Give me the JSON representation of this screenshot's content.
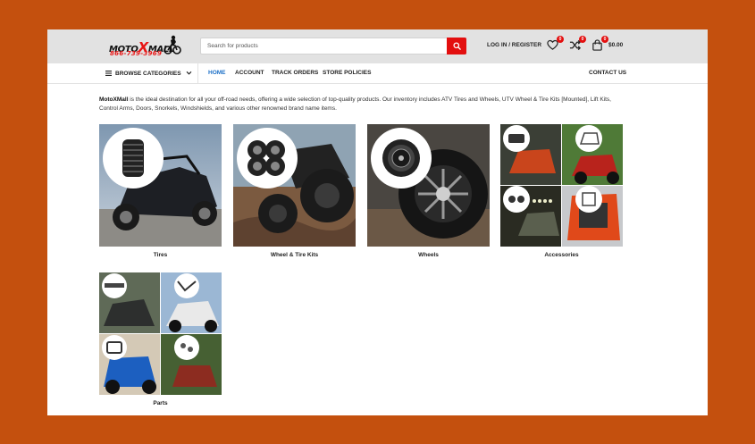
{
  "header": {
    "logo_text_a": "MOTO",
    "logo_text_x": "X",
    "logo_text_b": "MALL",
    "logo_phone": "866-739-3969",
    "search_placeholder": "Search for products",
    "login_label": "LOG IN / REGISTER",
    "wishlist_count": "0",
    "compare_count": "0",
    "cart_count": "0",
    "cart_total": "$0.00"
  },
  "nav": {
    "browse_label": "BROWSE CATEGORIES",
    "items": [
      "HOME",
      "ACCOUNT",
      "TRACK ORDERS",
      "STORE POLICIES"
    ],
    "contact_label": "CONTACT US"
  },
  "intro": {
    "brand": "MotoXMall",
    "text": " is the ideal destination for all your off-road needs, offering a wide selection of top-quality products. Our inventory includes ATV Tires and Wheels, UTV Wheel & Tire Kits [Mounted], Lift Kits, Control Arms, Doors, Snorkels, Windshields, and various other renowned brand name items."
  },
  "categories": [
    {
      "label": "Tires"
    },
    {
      "label": "Wheel & Tire Kits"
    },
    {
      "label": "Wheels"
    },
    {
      "label": "Accessories"
    },
    {
      "label": "Parts"
    }
  ],
  "colors": {
    "accent_red": "#e30f0f",
    "nav_active": "#1b6fc7",
    "outer_background": "#c4500e",
    "header_background": "#e2e2e2"
  },
  "icons": {
    "logo": "motorcycle-rider-icon",
    "search": "search-icon",
    "wishlist": "heart-icon",
    "compare": "shuffle-icon",
    "cart": "shopping-bag-icon",
    "browse": "hamburger-icon",
    "dropdown": "chevron-down-icon"
  }
}
